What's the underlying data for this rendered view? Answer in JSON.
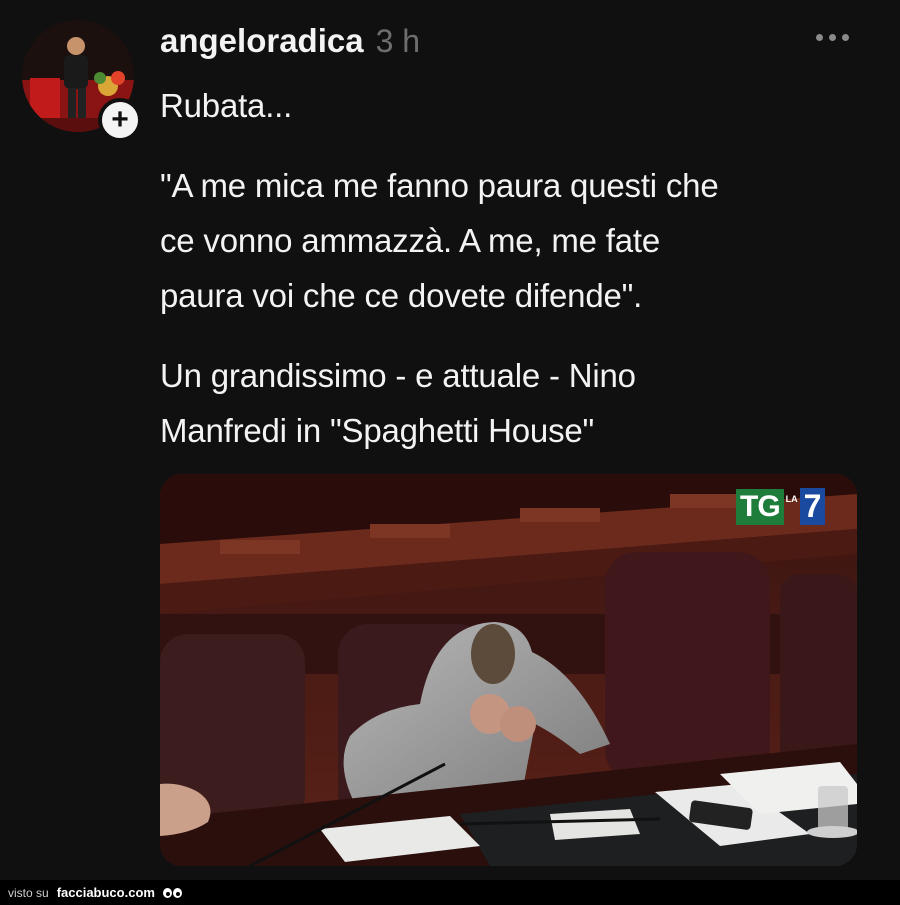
{
  "post": {
    "username": "angeloradica",
    "timestamp": "3 h",
    "follow_symbol": "+",
    "more_icon": "more-horizontal-icon",
    "line_1": "Rubata...",
    "quote_lines": [
      "\"A me mica me fanno paura questi che",
      "ce vonno ammazzà. A me, me fate",
      "paura voi che ce dovete difende\"."
    ],
    "desc_lines": [
      "Un grandissimo - e attuale - Nino",
      "Manfredi in \"Spaghetti House\""
    ],
    "media_logo": {
      "tg": "TG",
      "la": "LA",
      "seven": "7"
    }
  },
  "footer": {
    "prefix": "visto su",
    "site": "facciabuco.com"
  },
  "colors": {
    "background": "#101010",
    "text": "#f3f3f3",
    "muted": "#6e6e6e",
    "tg_green": "#1e7d3a",
    "tg_blue": "#1a4aa0"
  }
}
